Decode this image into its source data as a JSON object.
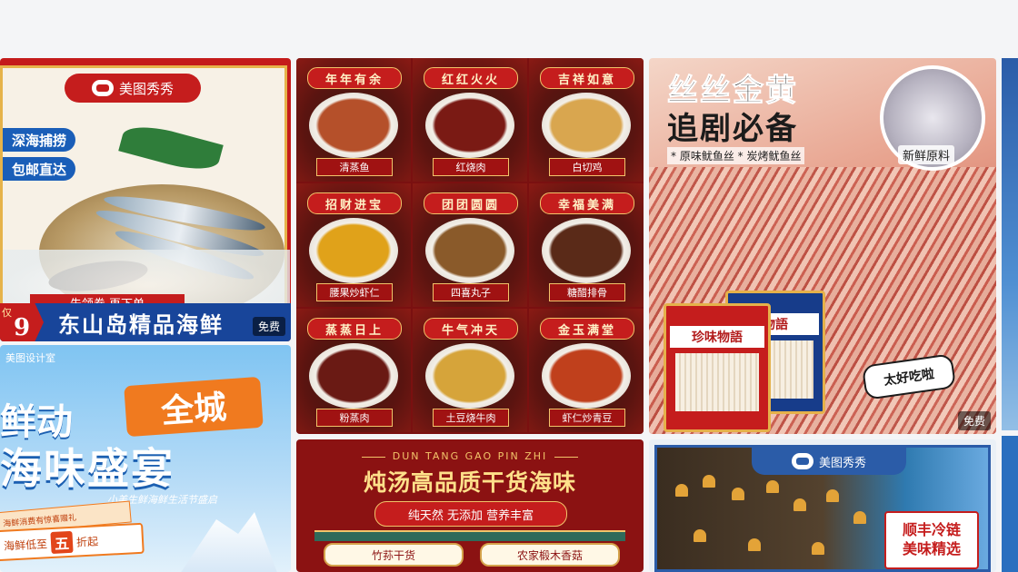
{
  "feed": {
    "free_label": "免费",
    "cards": {
      "seafood": {
        "brand": "美图秀秀",
        "line1": "深海捕捞",
        "line2": "包邮直达",
        "coupon": "先领券 再下单",
        "price_prefix": "仅",
        "price": "9",
        "title": "东山岛精品海鲜"
      },
      "dishes": {
        "items": [
          {
            "head": "年年有余",
            "label": "清蒸鱼",
            "color": "#b5502a"
          },
          {
            "head": "红红火火",
            "label": "红烧肉",
            "color": "#7a1a14"
          },
          {
            "head": "吉祥如意",
            "label": "白切鸡",
            "color": "#d9a64f"
          },
          {
            "head": "招财进宝",
            "label": "腰果炒虾仁",
            "color": "#e0a21a"
          },
          {
            "head": "团团圆圆",
            "label": "四喜丸子",
            "color": "#8a5a2a"
          },
          {
            "head": "幸福美满",
            "label": "糖醋排骨",
            "color": "#5a2a18"
          },
          {
            "head": "蒸蒸日上",
            "label": "粉蒸肉",
            "color": "#6a1a14"
          },
          {
            "head": "牛气冲天",
            "label": "土豆烧牛肉",
            "color": "#d6a43a"
          },
          {
            "head": "金玉满堂",
            "label": "虾仁炒青豆",
            "color": "#c0401c"
          }
        ]
      },
      "squid": {
        "line1": "丝丝金黄",
        "line2": "追剧必备",
        "sub": "* 原味鱿鱼丝  * 炭烤鱿鱼丝",
        "circle_label": "新鲜原料",
        "pack1": "珍味物語",
        "pack2": "物語",
        "badge": "太好吃啦"
      },
      "ocean": {
        "source": "美图设计室",
        "line1": "鲜动",
        "line1_box": "全城",
        "line2": "海味盛宴",
        "slogan": "小美生鲜海鲜生活节盛启",
        "ticket1": "海鲜消费有惊喜赠礼",
        "ticket2_prefix": "海鲜低至",
        "ticket2_num": "五",
        "ticket2_suffix": "折起"
      },
      "dunthang": {
        "pinyin": "DUN TANG GAO PIN ZHI",
        "title": "炖汤高品质干货海味",
        "tag": "纯天然 无添加 营养丰富",
        "sub1": "竹荪干货",
        "sub2": "农家椴木香菇"
      },
      "seacuc": {
        "brand": "美图秀秀",
        "label1": "顺丰冷链",
        "label2": "美味精选"
      }
    }
  }
}
